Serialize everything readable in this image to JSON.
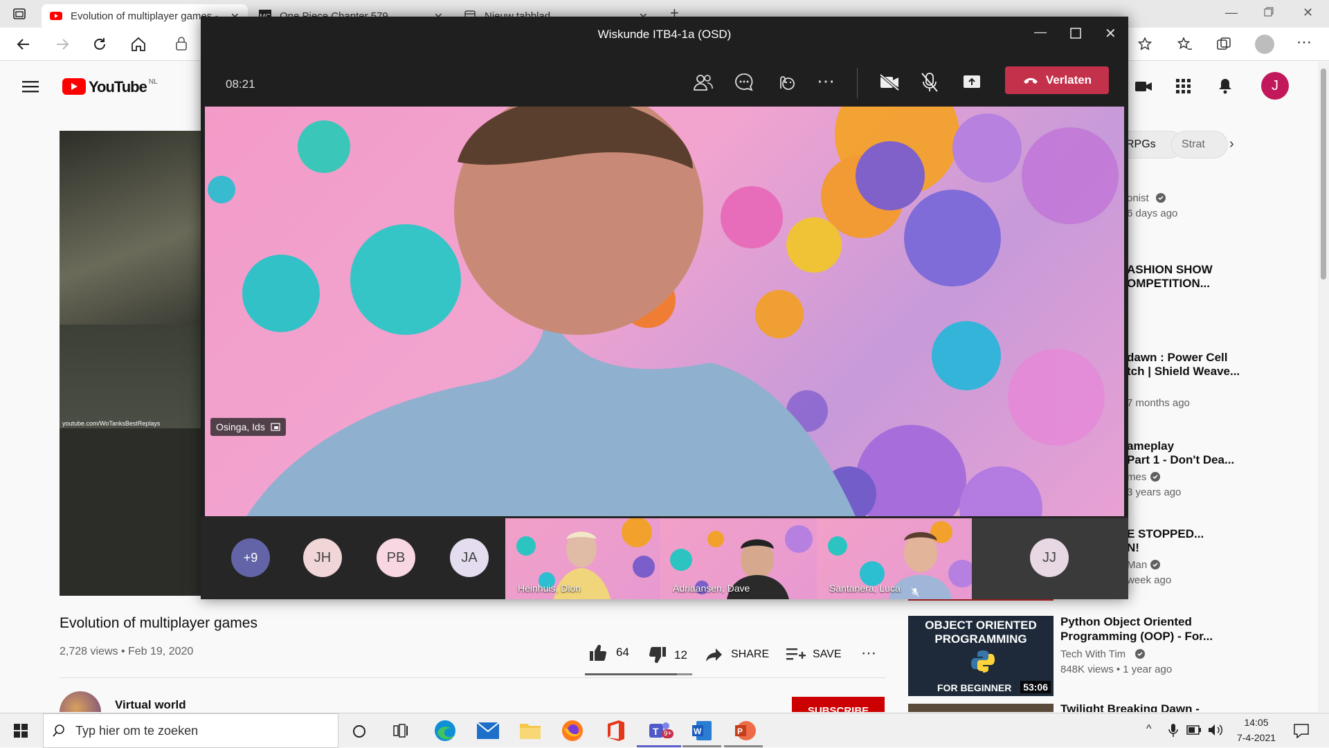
{
  "browser": {
    "tabs": [
      {
        "title": "Evolution of multiplayer games -",
        "active": true
      },
      {
        "title": "One Piece Chapter 579",
        "active": false
      },
      {
        "title": "Nieuw tabblad",
        "active": false
      }
    ],
    "profile_initial": "J"
  },
  "youtube": {
    "logo_text": "YouTube",
    "region": "NL",
    "avatar_initial": "J",
    "video": {
      "title": "Evolution of multiplayer games",
      "meta": "2,728 views • Feb 19, 2020",
      "likes": "64",
      "dislikes": "12",
      "share_label": "SHARE",
      "save_label": "SAVE",
      "watermark": "youtube.com/WoTanksBestReplays"
    },
    "channel": {
      "name": "Virtual world",
      "subscribe_label": "SUBSCRIBE"
    },
    "chips": [
      "RPGs",
      "Strat"
    ],
    "sidebar": [
      {
        "line1": "onist",
        "line2": "6 days ago"
      },
      {
        "line1": "ASHION SHOW",
        "line2": "OMPETITION..."
      },
      {
        "line1": "dawn : Power Cell",
        "line2": "tch | Shield Weave...",
        "line3": "7 months ago"
      },
      {
        "line1": "ameplay",
        "line2": "Part 1 - Don't Dea...",
        "line3": "mes",
        "line4": "3 years ago"
      },
      {
        "line1": "E STOPPED...",
        "line2": "N!",
        "line3": "Man",
        "line4": "week ago"
      }
    ],
    "rec": {
      "title_line1": "Python Object Oriented",
      "title_line2": "Programming (OOP) - For...",
      "channel": "Tech With Tim",
      "meta": "848K views • 1 year ago",
      "thumb_line1": "OBJECT ORIENTED",
      "thumb_line2": "PROGRAMMING",
      "thumb_line3": "FOR BEGINNER",
      "duration": "53:06"
    },
    "next_title": "Twilight Breaking Dawn -"
  },
  "teams": {
    "window_title": "Wiskunde ITB4-1a (OSD)",
    "elapsed": "08:21",
    "leave_label": "Verlaten",
    "speaker_name": "Osinga, Ids",
    "overflow_count": "+9",
    "avatars": [
      "JH",
      "PB",
      "JA",
      "JJ"
    ],
    "tiles": [
      "Heinhuis, Dion",
      "Adriaansen, Dave",
      "Santanera, Luca"
    ]
  },
  "taskbar": {
    "search_placeholder": "Typ hier om te zoeken",
    "time": "14:05",
    "date": "7-4-2021",
    "teams_badge": "9+"
  }
}
